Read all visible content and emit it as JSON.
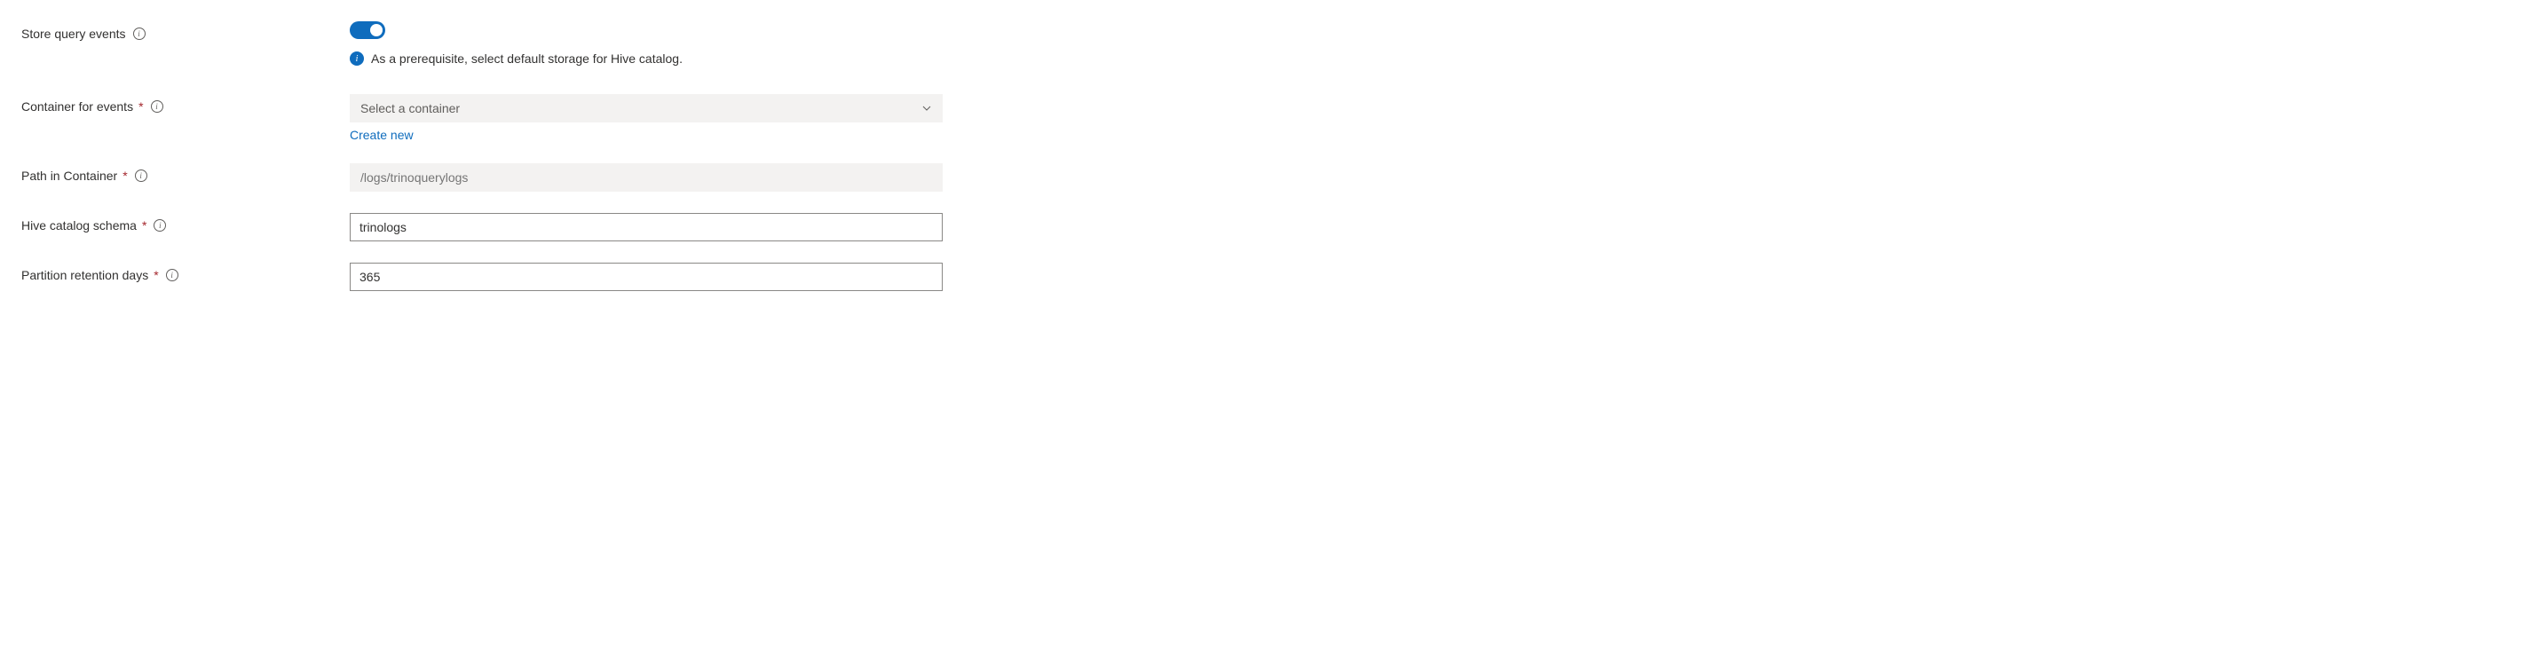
{
  "fields": {
    "storeQueryEvents": {
      "label": "Store query events",
      "enabled": true,
      "prerequisite": "As a prerequisite, select default storage for Hive catalog."
    },
    "containerForEvents": {
      "label": "Container for events",
      "placeholder": "Select a container",
      "createNew": "Create new"
    },
    "pathInContainer": {
      "label": "Path in Container",
      "placeholder": "/logs/trinoquerylogs"
    },
    "hiveCatalogSchema": {
      "label": "Hive catalog schema",
      "value": "trinologs"
    },
    "partitionRetentionDays": {
      "label": "Partition retention days",
      "value": "365"
    }
  }
}
